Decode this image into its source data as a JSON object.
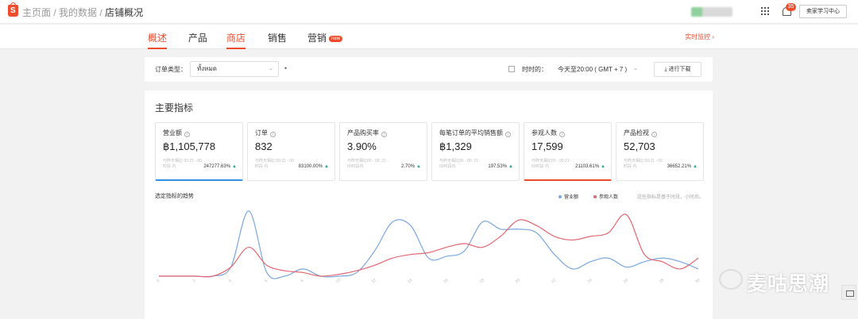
{
  "header": {
    "breadcrumb": [
      "主页面",
      "我的数据",
      "店铺概况"
    ],
    "separator": " / ",
    "notification_count": "35",
    "seller_center": "卖家学习中心"
  },
  "nav": {
    "tabs": [
      {
        "label": "概述",
        "active": true
      },
      {
        "label": "产品",
        "active": false
      },
      {
        "label": "商店",
        "active": true
      },
      {
        "label": "销售",
        "active": false
      },
      {
        "label": "营销",
        "active": false,
        "badge": "new"
      }
    ],
    "realtime": "实时监控 ›"
  },
  "filter": {
    "order_type_label": "订单类型：",
    "order_type_value": "ทั้งหมด",
    "period_label": "时时的：",
    "period_value": "今天至20:00 ( GMT + 7 )",
    "export_label": "进行下载"
  },
  "main": {
    "title": "主要指标",
    "cards": [
      {
        "title": "营业额",
        "value": "฿1,105,778",
        "sub": "与昨天相比\n00:21 - 00时段\n内",
        "change": "247277.63%",
        "accent": "blue"
      },
      {
        "title": "订单",
        "value": "832",
        "sub": "与昨天相比\n00:21 - 00时段\n内",
        "change": "83100.00%",
        "accent": ""
      },
      {
        "title": "产品购买率",
        "value": "3.90%",
        "sub": "与昨天相比00 - 00:\n21 - 00时段内",
        "change": "2.70%",
        "accent": ""
      },
      {
        "title": "每笔订单的平均销售额",
        "value": "฿1,329",
        "sub": "与昨天相比00 - 00:\n21 - 00时段内",
        "change": "197.53%",
        "accent": ""
      },
      {
        "title": "参观人数",
        "value": "17,599",
        "sub": "与昨天相比00 -\n00:21 - 00时段\n内",
        "change": "21103.61%",
        "accent": "red"
      },
      {
        "title": "产品检视",
        "value": "52,703",
        "sub": "与昨天相比\n00:21 - 00时段\n内",
        "change": "36652.21%",
        "accent": ""
      }
    ],
    "chart_subtitle": "选定指标的趋势",
    "legend_note": "这些指标是基于时段，小时后。"
  },
  "chart_data": {
    "type": "line",
    "x": [
      "0",
      "1",
      "2",
      "3",
      "4",
      "5",
      "6",
      "7",
      "8",
      "9",
      "10",
      "11",
      "12",
      "13",
      "14",
      "15",
      "16",
      "17",
      "18",
      "19",
      "20",
      "21",
      "22",
      "23",
      "24",
      "25",
      "26",
      "27",
      "28",
      "29",
      "30"
    ],
    "series": [
      {
        "name": "营业额",
        "color": "#7aa7e0",
        "values": [
          0,
          0,
          0,
          0,
          5,
          36,
          2,
          0,
          4,
          0,
          0,
          2,
          14,
          30,
          28,
          10,
          11,
          14,
          30,
          26,
          26,
          24,
          12,
          4,
          8,
          10,
          5,
          8,
          10,
          8,
          4
        ]
      },
      {
        "name": "参观人数",
        "color": "#e26770",
        "values": [
          0,
          0,
          0,
          0,
          5,
          16,
          6,
          3,
          2,
          0,
          1,
          3,
          6,
          10,
          12,
          13,
          16,
          18,
          16,
          22,
          31,
          28,
          22,
          20,
          22,
          24,
          34,
          12,
          8,
          4,
          10
        ]
      }
    ],
    "grid": false,
    "legend": "top-right"
  }
}
